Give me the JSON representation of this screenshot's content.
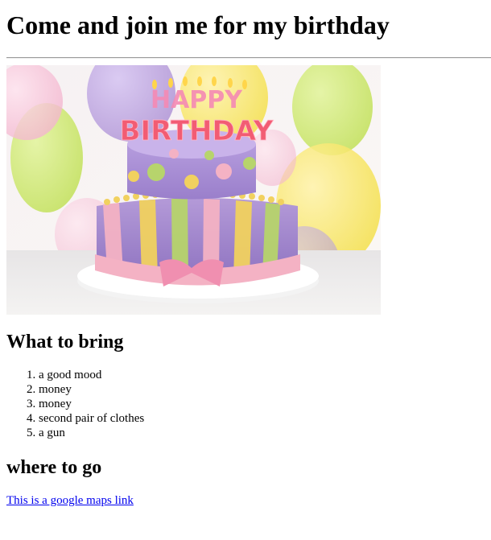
{
  "page": {
    "title": "Come and join me for my birthday",
    "image": {
      "alt": "HAPPY BIRTHDAY",
      "candle_letters_top": "HAPPY",
      "candle_letters_bottom": "BIRTHDAY",
      "accent_colors": {
        "balloon_purple": "#b49ad8",
        "balloon_green": "#c8e36a",
        "balloon_yellow": "#f4e04d",
        "balloon_pink": "#f3b6cf",
        "cake_purple": "#a78bd2",
        "cake_pink": "#f4b2c4",
        "cake_yellow": "#f1d15f",
        "cake_green": "#b7d46c",
        "board_white": "#f3f3f3"
      }
    },
    "bring_heading": "What to bring",
    "bring_items": [
      "a good mood",
      "money",
      "money",
      "second pair of clothes",
      "a gun"
    ],
    "where_heading": "where to go",
    "maps_link_text": "This is a google maps link"
  }
}
